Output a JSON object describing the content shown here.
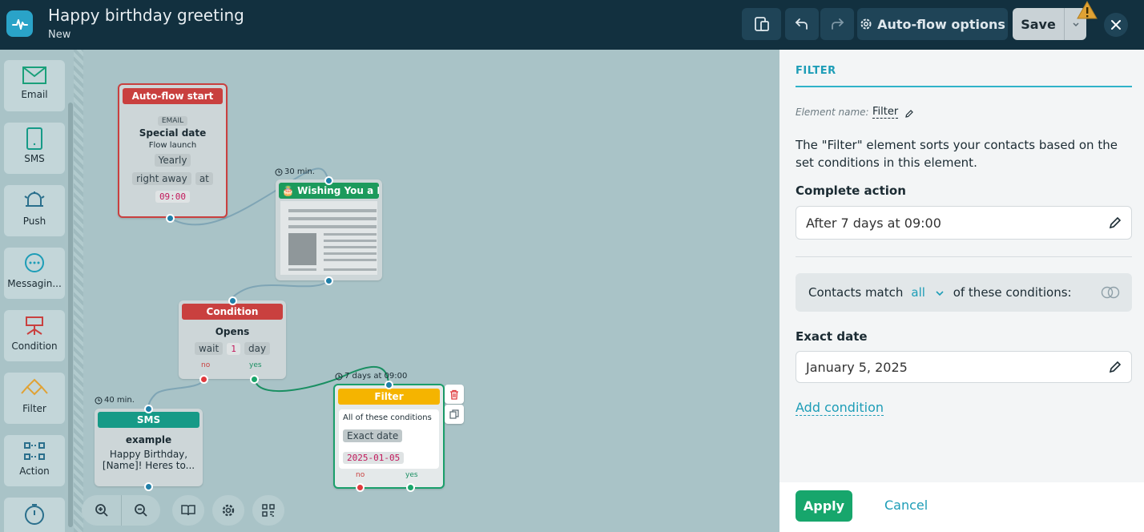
{
  "header": {
    "title": "Happy birthday greeting",
    "subtitle": "New",
    "auto_flow_label": "Auto-flow options",
    "save_label": "Save"
  },
  "palette": {
    "items": [
      {
        "label": "Email",
        "icon": "email-icon"
      },
      {
        "label": "SMS",
        "icon": "phone-icon"
      },
      {
        "label": "Push",
        "icon": "bell-icon"
      },
      {
        "label": "Messagin...",
        "icon": "chat-icon"
      },
      {
        "label": "Condition",
        "icon": "condition-icon"
      },
      {
        "label": "Filter",
        "icon": "filter-icon"
      },
      {
        "label": "Action",
        "icon": "action-icon"
      }
    ]
  },
  "canvas": {
    "start_node": {
      "title": "Auto-flow start",
      "channel": "EMAIL",
      "trigger": "Special date",
      "mode": "Flow launch",
      "frequency": "Yearly",
      "timing": "right away",
      "at_label": "at",
      "time": "09:00"
    },
    "email_node": {
      "delay": "30 min.",
      "title": "🎂 Wishing You a F..."
    },
    "condition_node": {
      "title": "Condition",
      "event": "Opens",
      "wait_label": "wait",
      "wait_value": "1",
      "wait_unit": "day",
      "no_label": "no",
      "yes_label": "yes"
    },
    "sms_node": {
      "delay": "40 min.",
      "title": "SMS",
      "name": "example",
      "preview": "Happy Birthday, [Name]! Heres to..."
    },
    "filter_node": {
      "delay": "7 days at 09:00",
      "title": "Filter",
      "conditions_label": "All of these conditions",
      "condition_type": "Exact date",
      "condition_value": "2025-01-05",
      "no_label": "no",
      "yes_label": "yes"
    }
  },
  "panel": {
    "title": "FILTER",
    "element_name_label": "Element name:",
    "element_name_value": "Filter",
    "description": "The \"Filter\" element sorts your contacts based on the set conditions in this element.",
    "complete_action_label": "Complete action",
    "complete_action_value": "After 7 days at 09:00",
    "match_prefix": "Contacts match",
    "match_value": "all",
    "match_suffix": "of these conditions:",
    "exact_date_label": "Exact date",
    "exact_date_value": "January 5, 2025",
    "add_condition_label": "Add condition",
    "apply_label": "Apply",
    "cancel_label": "Cancel"
  },
  "colors": {
    "header_bg": "#12303f",
    "accent": "#1d9db7",
    "start_red": "#c9403f",
    "email_green": "#1c9a5c",
    "sms_teal": "#169a87",
    "filter_yellow": "#f5b400",
    "apply_green": "#17a66c"
  }
}
